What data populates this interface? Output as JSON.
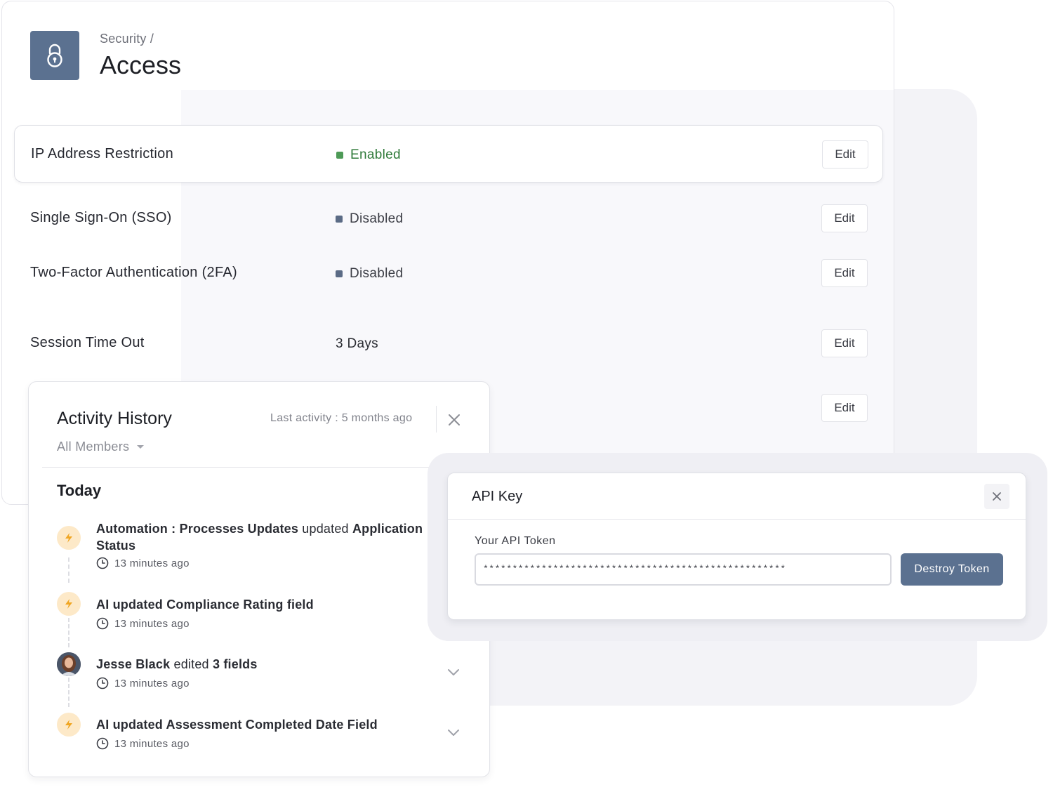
{
  "header": {
    "breadcrumb": "Security /",
    "title": "Access",
    "icon": "lock-icon",
    "icon_bg": "#5b7190"
  },
  "settings": [
    {
      "label": "IP Address Restriction",
      "status": "Enabled",
      "status_color": "#4e9a57",
      "text_color": "#2f7a3a",
      "edit": "Edit"
    },
    {
      "label": "Single Sign-On (SSO)",
      "status": "Disabled",
      "status_color": "#5b6b85",
      "text_color": "#3b3d45",
      "edit": "Edit"
    },
    {
      "label": "Two-Factor Authentication (2FA)",
      "status": "Disabled",
      "status_color": "#5b6b85",
      "text_color": "#3b3d45",
      "edit": "Edit"
    },
    {
      "label": "Session Time Out",
      "status": "3 Days",
      "edit": "Edit"
    }
  ],
  "extra_edit": "Edit",
  "activity": {
    "title": "Activity History",
    "last_activity": "Last activity : 5 months ago",
    "filter": "All Members",
    "section": "Today",
    "items": [
      {
        "icon": "bolt-icon",
        "pre": "Automation : Processes Updates",
        "mid": " updated ",
        "post": "Application Status",
        "time": "13 minutes ago"
      },
      {
        "icon": "bolt-icon",
        "pre": "AI updated Compliance Rating field",
        "mid": "",
        "post": "",
        "time": "13 minutes ago"
      },
      {
        "icon": "avatar",
        "pre": "Jesse Black",
        "mid": " edited ",
        "post": "3 fields",
        "time": "13 minutes ago"
      },
      {
        "icon": "bolt-icon",
        "pre": "AI updated Assessment Completed Date Field",
        "mid": "",
        "post": "",
        "time": "13 minutes ago"
      }
    ]
  },
  "api_key": {
    "title": "API Key",
    "token_label": "Your API Token",
    "token_value": "****************************************************",
    "destroy_label": "Destroy Token",
    "button_color": "#5b7190"
  }
}
